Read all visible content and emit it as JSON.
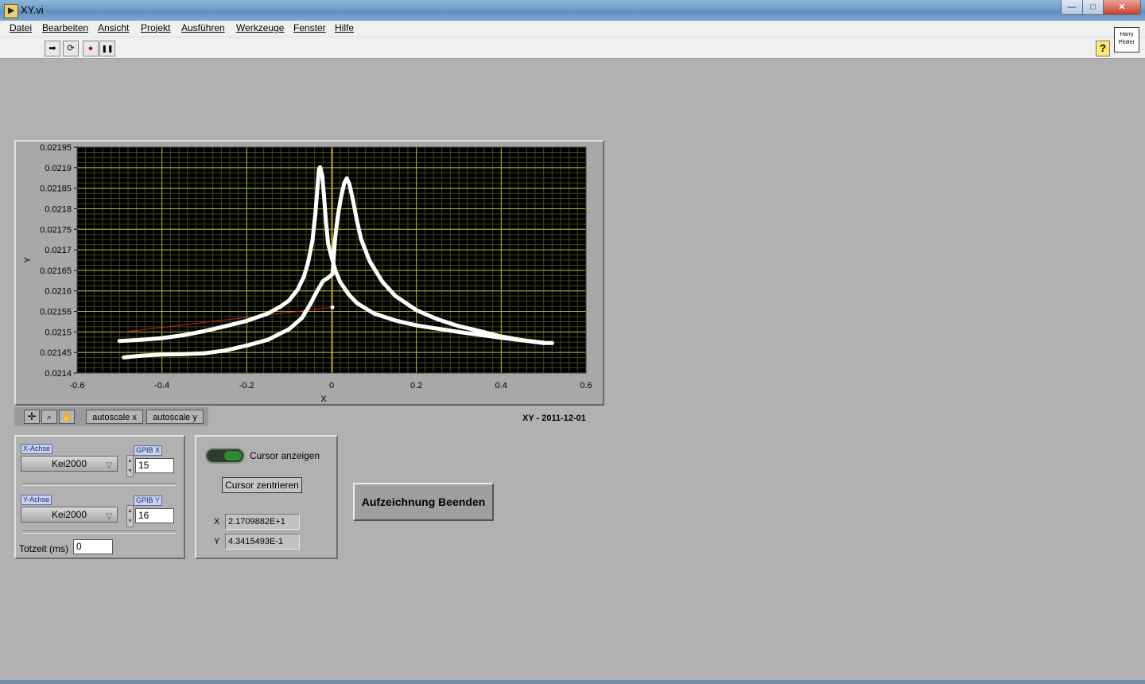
{
  "window": {
    "title": "XY.vi",
    "min": "—",
    "max": "□",
    "close": "✕"
  },
  "menu": [
    "Datei",
    "Bearbeiten",
    "Ansicht",
    "Projekt",
    "Ausführen",
    "Werkzeuge",
    "Fenster",
    "Hilfe"
  ],
  "toolbar": {
    "run": "➡",
    "run_continuous": "⟳",
    "abort": "●",
    "pause": "❚❚",
    "help": "?",
    "vi_icon": "Harry Plotter"
  },
  "graph": {
    "caption": "XY - 2011-12-01",
    "palette": {
      "autoscale_x": "autoscale x",
      "autoscale_y": "autoscale y"
    }
  },
  "chart_data": {
    "type": "scatter",
    "xlabel": "X",
    "ylabel": "Y",
    "xlim": [
      -0.6,
      0.6
    ],
    "ylim": [
      0.0214,
      0.02195
    ],
    "xticks": [
      "-0.6",
      "-0.4",
      "-0.2",
      "0",
      "0.2",
      "0.4",
      "0.6"
    ],
    "yticks": [
      "0.0214",
      "0.02145",
      "0.0215",
      "0.02155",
      "0.0216",
      "0.02165",
      "0.0217",
      "0.02175",
      "0.0218",
      "0.02185",
      "0.0219",
      "0.02195"
    ],
    "series": [
      {
        "points": [
          [
            -0.5,
            0.021478
          ],
          [
            -0.45,
            0.021481
          ],
          [
            -0.4,
            0.021485
          ],
          [
            -0.35,
            0.021492
          ],
          [
            -0.3,
            0.021502
          ],
          [
            -0.25,
            0.021514
          ],
          [
            -0.2,
            0.021527
          ],
          [
            -0.15,
            0.021545
          ],
          [
            -0.12,
            0.021562
          ],
          [
            -0.1,
            0.021577
          ],
          [
            -0.08,
            0.021603
          ],
          [
            -0.065,
            0.021635
          ],
          [
            -0.055,
            0.021671
          ],
          [
            -0.045,
            0.021723
          ],
          [
            -0.038,
            0.02179
          ],
          [
            -0.033,
            0.021855
          ],
          [
            -0.03,
            0.021895
          ],
          [
            -0.027,
            0.021901
          ],
          [
            -0.022,
            0.02188
          ],
          [
            -0.018,
            0.021833
          ],
          [
            -0.013,
            0.021765
          ],
          [
            -0.008,
            0.021714
          ],
          [
            0,
            0.021682
          ],
          [
            0.01,
            0.021647
          ],
          [
            0.02,
            0.021622
          ],
          [
            0.04,
            0.021592
          ],
          [
            0.06,
            0.02157
          ],
          [
            0.1,
            0.021545
          ],
          [
            0.15,
            0.021528
          ],
          [
            0.2,
            0.021516
          ],
          [
            0.3,
            0.0215
          ],
          [
            0.4,
            0.021486
          ],
          [
            0.5,
            0.021473
          ],
          [
            0.52,
            0.021473
          ]
        ]
      },
      {
        "points": [
          [
            -0.49,
            0.021438
          ],
          [
            -0.45,
            0.021442
          ],
          [
            -0.4,
            0.021445
          ],
          [
            -0.35,
            0.021446
          ],
          [
            -0.3,
            0.021448
          ],
          [
            -0.25,
            0.021455
          ],
          [
            -0.2,
            0.021467
          ],
          [
            -0.15,
            0.021481
          ],
          [
            -0.1,
            0.021507
          ],
          [
            -0.07,
            0.021534
          ],
          [
            -0.05,
            0.021568
          ],
          [
            -0.035,
            0.021598
          ],
          [
            -0.02,
            0.021624
          ],
          [
            -0.008,
            0.021632
          ],
          [
            0.002,
            0.021641
          ],
          [
            0.004,
            0.021663
          ],
          [
            0.008,
            0.021725
          ],
          [
            0.015,
            0.021784
          ],
          [
            0.022,
            0.021826
          ],
          [
            0.03,
            0.021863
          ],
          [
            0.036,
            0.021874
          ],
          [
            0.042,
            0.02186
          ],
          [
            0.05,
            0.021823
          ],
          [
            0.06,
            0.02177
          ],
          [
            0.07,
            0.021725
          ],
          [
            0.09,
            0.021672
          ],
          [
            0.12,
            0.021622
          ],
          [
            0.15,
            0.021588
          ],
          [
            0.2,
            0.021553
          ],
          [
            0.25,
            0.021531
          ],
          [
            0.3,
            0.021514
          ],
          [
            0.35,
            0.021502
          ],
          [
            0.4,
            0.021489
          ],
          [
            0.45,
            0.02148
          ],
          [
            0.5,
            0.021474
          ]
        ]
      }
    ],
    "cursor": {
      "x": 0.002,
      "y": 0.02156
    }
  },
  "controls": {
    "x_axis": {
      "label": "X-Achse",
      "value": "Kei2000",
      "gpib_label": "GPIB X",
      "gpib_value": "15"
    },
    "y_axis": {
      "label": "Y-Achse",
      "value": "Kei2000",
      "gpib_label": "GPIB Y",
      "gpib_value": "16"
    },
    "deadtime": {
      "label": "Totzeit (ms)",
      "value": "0"
    }
  },
  "cursor_panel": {
    "show_label": "Cursor anzeigen",
    "center_button": "Cursor zentrieren",
    "x_label": "X",
    "x_value": "2.1709882E+1",
    "y_label": "Y",
    "y_value": "4.3415493E-1"
  },
  "stop_button": "Aufzeichnung Beenden",
  "colors": {
    "plot_bg": "#000000",
    "grid_major": "#b7b72e",
    "grid_minor": "#3c4a1e",
    "trace": "#ffffff",
    "cursor": "#d02020"
  }
}
